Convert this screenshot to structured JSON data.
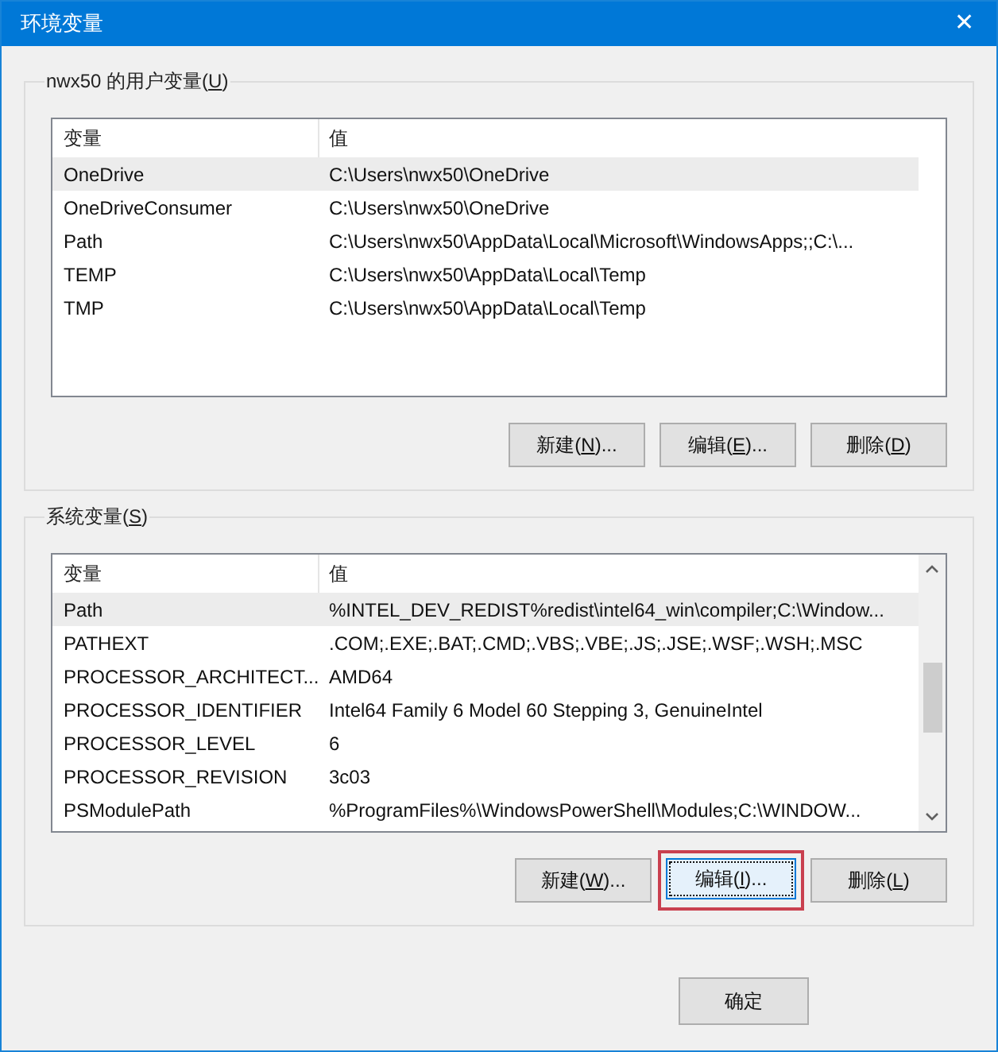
{
  "window": {
    "title": "环境变量",
    "close": "✕"
  },
  "user_variables": {
    "label": {
      "prefix": "nwx50 的用户变量(",
      "key": "U",
      "suffix": ")"
    },
    "columns": [
      "变量",
      "值"
    ],
    "rows": [
      {
        "name": "OneDrive",
        "value": "C:\\Users\\nwx50\\OneDrive",
        "selected": true
      },
      {
        "name": "OneDriveConsumer",
        "value": "C:\\Users\\nwx50\\OneDrive",
        "selected": false
      },
      {
        "name": "Path",
        "value": "C:\\Users\\nwx50\\AppData\\Local\\Microsoft\\WindowsApps;;C:\\...",
        "selected": false
      },
      {
        "name": "TEMP",
        "value": "C:\\Users\\nwx50\\AppData\\Local\\Temp",
        "selected": false
      },
      {
        "name": "TMP",
        "value": "C:\\Users\\nwx50\\AppData\\Local\\Temp",
        "selected": false
      }
    ],
    "buttons": [
      {
        "prefix": "新建(",
        "key": "N",
        "suffix": ")...",
        "highlighted": false
      },
      {
        "prefix": "编辑(",
        "key": "E",
        "suffix": ")...",
        "highlighted": false
      },
      {
        "prefix": "删除(",
        "key": "D",
        "suffix": ")",
        "highlighted": false
      }
    ]
  },
  "system_variables": {
    "label": {
      "prefix": "系统变量(",
      "key": "S",
      "suffix": ")"
    },
    "columns": [
      "变量",
      "值"
    ],
    "rows": [
      {
        "name": "Path",
        "value": "%INTEL_DEV_REDIST%redist\\intel64_win\\compiler;C:\\Window...",
        "selected": true
      },
      {
        "name": "PATHEXT",
        "value": ".COM;.EXE;.BAT;.CMD;.VBS;.VBE;.JS;.JSE;.WSF;.WSH;.MSC",
        "selected": false
      },
      {
        "name": "PROCESSOR_ARCHITECT...",
        "value": "AMD64",
        "selected": false
      },
      {
        "name": "PROCESSOR_IDENTIFIER",
        "value": "Intel64 Family 6 Model 60 Stepping 3, GenuineIntel",
        "selected": false
      },
      {
        "name": "PROCESSOR_LEVEL",
        "value": "6",
        "selected": false
      },
      {
        "name": "PROCESSOR_REVISION",
        "value": "3c03",
        "selected": false
      },
      {
        "name": "PSModulePath",
        "value": "%ProgramFiles%\\WindowsPowerShell\\Modules;C:\\WINDOW...",
        "selected": false
      }
    ],
    "buttons": [
      {
        "prefix": "新建(",
        "key": "W",
        "suffix": ")...",
        "highlighted": false
      },
      {
        "prefix": "编辑(",
        "key": "I",
        "suffix": ")...",
        "highlighted": true
      },
      {
        "prefix": "删除(",
        "key": "L",
        "suffix": ")",
        "highlighted": false
      }
    ]
  },
  "footer_buttons": [
    {
      "label": "确定"
    }
  ]
}
